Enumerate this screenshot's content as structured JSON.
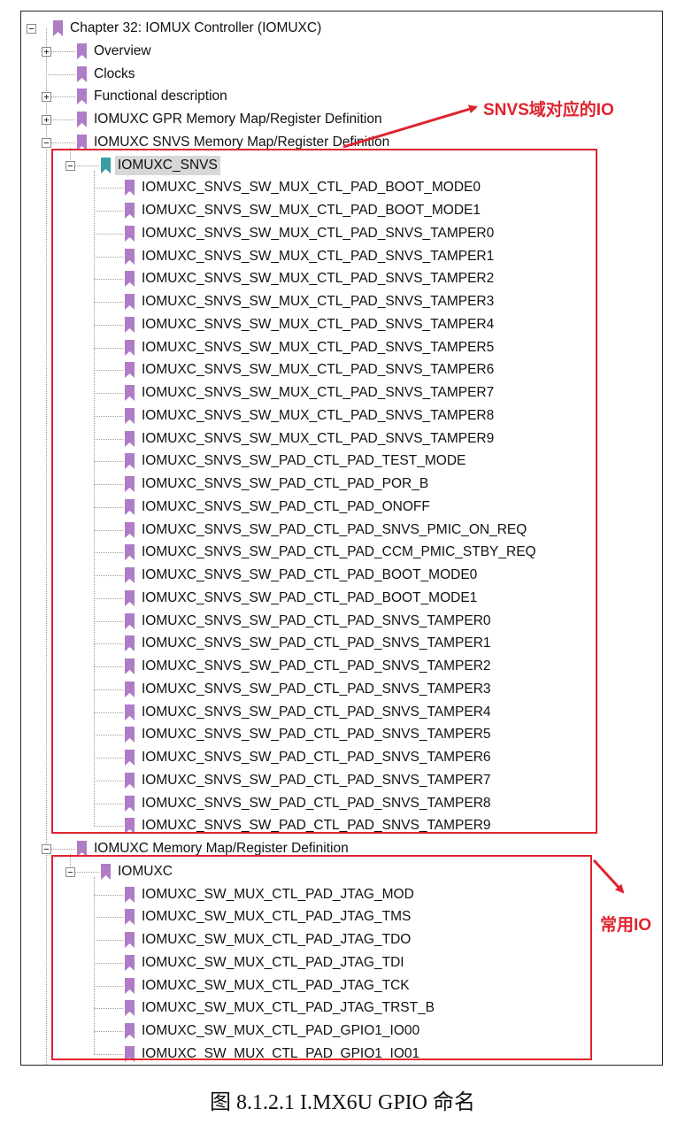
{
  "colors": {
    "bookmark": "#b07cc6",
    "bookmark_selected": "#3a9ea0",
    "annotation": "#e0232e",
    "selection": "#d7d7d7"
  },
  "tree": [
    {
      "label": "Chapter 32: IOMUX Controller (IOMUXC)",
      "level": 0,
      "toggle": "minus"
    },
    {
      "label": "Overview",
      "level": 1,
      "toggle": "plus"
    },
    {
      "label": "Clocks",
      "level": 1,
      "toggle": "none"
    },
    {
      "label": "Functional description",
      "level": 1,
      "toggle": "plus"
    },
    {
      "label": "IOMUXC GPR Memory Map/Register Definition",
      "level": 1,
      "toggle": "plus"
    },
    {
      "label": "IOMUXC SNVS Memory Map/Register Definition",
      "level": 1,
      "toggle": "minus"
    },
    {
      "label": "IOMUXC_SNVS",
      "level": 2,
      "toggle": "minus",
      "selected": true
    },
    {
      "label": "IOMUXC_SNVS_SW_MUX_CTL_PAD_BOOT_MODE0",
      "level": 3,
      "toggle": "none"
    },
    {
      "label": "IOMUXC_SNVS_SW_MUX_CTL_PAD_BOOT_MODE1",
      "level": 3,
      "toggle": "none"
    },
    {
      "label": "IOMUXC_SNVS_SW_MUX_CTL_PAD_SNVS_TAMPER0",
      "level": 3,
      "toggle": "none"
    },
    {
      "label": "IOMUXC_SNVS_SW_MUX_CTL_PAD_SNVS_TAMPER1",
      "level": 3,
      "toggle": "none"
    },
    {
      "label": "IOMUXC_SNVS_SW_MUX_CTL_PAD_SNVS_TAMPER2",
      "level": 3,
      "toggle": "none"
    },
    {
      "label": "IOMUXC_SNVS_SW_MUX_CTL_PAD_SNVS_TAMPER3",
      "level": 3,
      "toggle": "none"
    },
    {
      "label": "IOMUXC_SNVS_SW_MUX_CTL_PAD_SNVS_TAMPER4",
      "level": 3,
      "toggle": "none"
    },
    {
      "label": "IOMUXC_SNVS_SW_MUX_CTL_PAD_SNVS_TAMPER5",
      "level": 3,
      "toggle": "none"
    },
    {
      "label": "IOMUXC_SNVS_SW_MUX_CTL_PAD_SNVS_TAMPER6",
      "level": 3,
      "toggle": "none"
    },
    {
      "label": "IOMUXC_SNVS_SW_MUX_CTL_PAD_SNVS_TAMPER7",
      "level": 3,
      "toggle": "none"
    },
    {
      "label": "IOMUXC_SNVS_SW_MUX_CTL_PAD_SNVS_TAMPER8",
      "level": 3,
      "toggle": "none"
    },
    {
      "label": "IOMUXC_SNVS_SW_MUX_CTL_PAD_SNVS_TAMPER9",
      "level": 3,
      "toggle": "none"
    },
    {
      "label": "IOMUXC_SNVS_SW_PAD_CTL_PAD_TEST_MODE",
      "level": 3,
      "toggle": "none"
    },
    {
      "label": "IOMUXC_SNVS_SW_PAD_CTL_PAD_POR_B",
      "level": 3,
      "toggle": "none"
    },
    {
      "label": "IOMUXC_SNVS_SW_PAD_CTL_PAD_ONOFF",
      "level": 3,
      "toggle": "none"
    },
    {
      "label": "IOMUXC_SNVS_SW_PAD_CTL_PAD_SNVS_PMIC_ON_REQ",
      "level": 3,
      "toggle": "none"
    },
    {
      "label": "IOMUXC_SNVS_SW_PAD_CTL_PAD_CCM_PMIC_STBY_REQ",
      "level": 3,
      "toggle": "none"
    },
    {
      "label": "IOMUXC_SNVS_SW_PAD_CTL_PAD_BOOT_MODE0",
      "level": 3,
      "toggle": "none"
    },
    {
      "label": "IOMUXC_SNVS_SW_PAD_CTL_PAD_BOOT_MODE1",
      "level": 3,
      "toggle": "none"
    },
    {
      "label": "IOMUXC_SNVS_SW_PAD_CTL_PAD_SNVS_TAMPER0",
      "level": 3,
      "toggle": "none"
    },
    {
      "label": "IOMUXC_SNVS_SW_PAD_CTL_PAD_SNVS_TAMPER1",
      "level": 3,
      "toggle": "none"
    },
    {
      "label": "IOMUXC_SNVS_SW_PAD_CTL_PAD_SNVS_TAMPER2",
      "level": 3,
      "toggle": "none"
    },
    {
      "label": "IOMUXC_SNVS_SW_PAD_CTL_PAD_SNVS_TAMPER3",
      "level": 3,
      "toggle": "none"
    },
    {
      "label": "IOMUXC_SNVS_SW_PAD_CTL_PAD_SNVS_TAMPER4",
      "level": 3,
      "toggle": "none"
    },
    {
      "label": "IOMUXC_SNVS_SW_PAD_CTL_PAD_SNVS_TAMPER5",
      "level": 3,
      "toggle": "none"
    },
    {
      "label": "IOMUXC_SNVS_SW_PAD_CTL_PAD_SNVS_TAMPER6",
      "level": 3,
      "toggle": "none"
    },
    {
      "label": "IOMUXC_SNVS_SW_PAD_CTL_PAD_SNVS_TAMPER7",
      "level": 3,
      "toggle": "none"
    },
    {
      "label": "IOMUXC_SNVS_SW_PAD_CTL_PAD_SNVS_TAMPER8",
      "level": 3,
      "toggle": "none"
    },
    {
      "label": "IOMUXC_SNVS_SW_PAD_CTL_PAD_SNVS_TAMPER9",
      "level": 3,
      "toggle": "none"
    },
    {
      "label": "IOMUXC Memory Map/Register Definition",
      "level": 1,
      "toggle": "minus"
    },
    {
      "label": "IOMUXC",
      "level": 2,
      "toggle": "minus"
    },
    {
      "label": "IOMUXC_SW_MUX_CTL_PAD_JTAG_MOD",
      "level": 3,
      "toggle": "none"
    },
    {
      "label": "IOMUXC_SW_MUX_CTL_PAD_JTAG_TMS",
      "level": 3,
      "toggle": "none"
    },
    {
      "label": "IOMUXC_SW_MUX_CTL_PAD_JTAG_TDO",
      "level": 3,
      "toggle": "none"
    },
    {
      "label": "IOMUXC_SW_MUX_CTL_PAD_JTAG_TDI",
      "level": 3,
      "toggle": "none"
    },
    {
      "label": "IOMUXC_SW_MUX_CTL_PAD_JTAG_TCK",
      "level": 3,
      "toggle": "none"
    },
    {
      "label": "IOMUXC_SW_MUX_CTL_PAD_JTAG_TRST_B",
      "level": 3,
      "toggle": "none"
    },
    {
      "label": "IOMUXC_SW_MUX_CTL_PAD_GPIO1_IO00",
      "level": 3,
      "toggle": "none"
    },
    {
      "label": "IOMUXC_SW_MUX_CTL_PAD_GPIO1_IO01",
      "level": 3,
      "toggle": "none"
    }
  ],
  "annotations": {
    "snvs_note": "SNVS域对应的IO",
    "common_note": "常用IO"
  },
  "caption": "图 8.1.2.1 I.MX6U GPIO 命名"
}
